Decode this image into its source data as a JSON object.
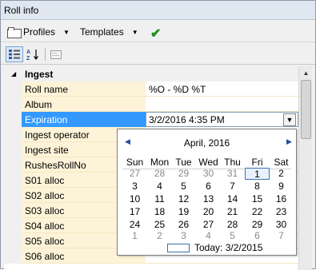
{
  "window": {
    "title": "Roll info"
  },
  "toolbar": {
    "profiles": "Profiles",
    "templates": "Templates"
  },
  "subtoolbar": {
    "categorized_icon": "categorized-view-icon",
    "alphabetical_icon": "sort-az-icon",
    "property_pages_icon": "property-pages-icon"
  },
  "grid": {
    "group": "Ingest",
    "rows": [
      {
        "name": "Roll name",
        "value": "%O - %D %T"
      },
      {
        "name": "Album",
        "value": ""
      },
      {
        "name": "Expiration",
        "value": "3/2/2016 4:35 PM"
      },
      {
        "name": "Ingest operator",
        "value": ""
      },
      {
        "name": "Ingest site",
        "value": ""
      },
      {
        "name": "RushesRollNo",
        "value": ""
      },
      {
        "name": "S01 alloc",
        "value": ""
      },
      {
        "name": "S02 alloc",
        "value": ""
      },
      {
        "name": "S03 alloc",
        "value": ""
      },
      {
        "name": "S04 alloc",
        "value": ""
      },
      {
        "name": "S05 alloc",
        "value": ""
      },
      {
        "name": "S06 alloc",
        "value": ""
      }
    ]
  },
  "calendar": {
    "title": "April, 2016",
    "weekdays": [
      "Sun",
      "Mon",
      "Tue",
      "Wed",
      "Thu",
      "Fri",
      "Sat"
    ],
    "weeks": [
      [
        "27",
        "28",
        "29",
        "30",
        "31",
        "1",
        "2"
      ],
      [
        "3",
        "4",
        "5",
        "6",
        "7",
        "8",
        "9"
      ],
      [
        "10",
        "11",
        "12",
        "13",
        "14",
        "15",
        "16"
      ],
      [
        "17",
        "18",
        "19",
        "20",
        "21",
        "22",
        "23"
      ],
      [
        "24",
        "25",
        "26",
        "27",
        "28",
        "29",
        "30"
      ],
      [
        "1",
        "2",
        "3",
        "4",
        "5",
        "6",
        "7"
      ]
    ],
    "today_label": "Today: 3/2/2015"
  }
}
